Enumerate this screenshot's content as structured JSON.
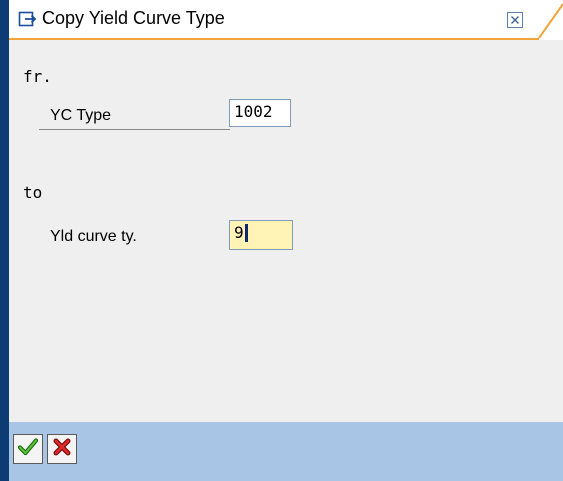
{
  "window": {
    "title": "Copy Yield Curve Type"
  },
  "from_section": {
    "label": "fr.",
    "field_label": "YC Type",
    "field_value": "1002"
  },
  "to_section": {
    "label": "to",
    "field_label": "Yld curve ty.",
    "field_value": "9"
  },
  "icons": {
    "title": "copy-dialog-icon",
    "close": "close-icon",
    "confirm": "checkmark-icon",
    "cancel": "cancel-x-icon"
  },
  "colors": {
    "active_field_bg": "#fff4b5",
    "footer_bg": "#a9c5e6",
    "confirm_green": "#2e8b1e",
    "cancel_red": "#cc1f1f",
    "title_accent": "#f2a33a"
  }
}
